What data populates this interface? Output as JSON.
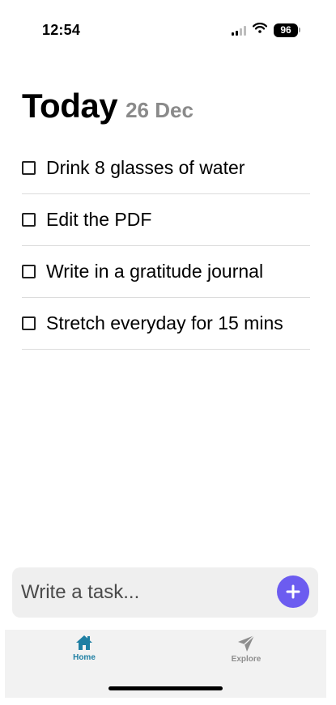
{
  "status_bar": {
    "time": "12:54",
    "battery": "96"
  },
  "header": {
    "title": "Today",
    "date": "26 Dec"
  },
  "tasks": [
    {
      "label": "Drink 8 glasses of water",
      "checked": false
    },
    {
      "label": "Edit the PDF",
      "checked": false
    },
    {
      "label": "Write in a gratitude journal",
      "checked": false
    },
    {
      "label": "Stretch everyday for 15 mins",
      "checked": false
    }
  ],
  "input": {
    "placeholder": "Write a task...",
    "value": ""
  },
  "add_button": {
    "icon": "plus-icon",
    "color": "#6c5cf0"
  },
  "tab_bar": {
    "tabs": [
      {
        "label": "Home",
        "icon": "home-icon",
        "active": true,
        "color": "#1f7fa3"
      },
      {
        "label": "Explore",
        "icon": "send-icon",
        "active": false,
        "color": "#8e8e8e"
      }
    ]
  }
}
